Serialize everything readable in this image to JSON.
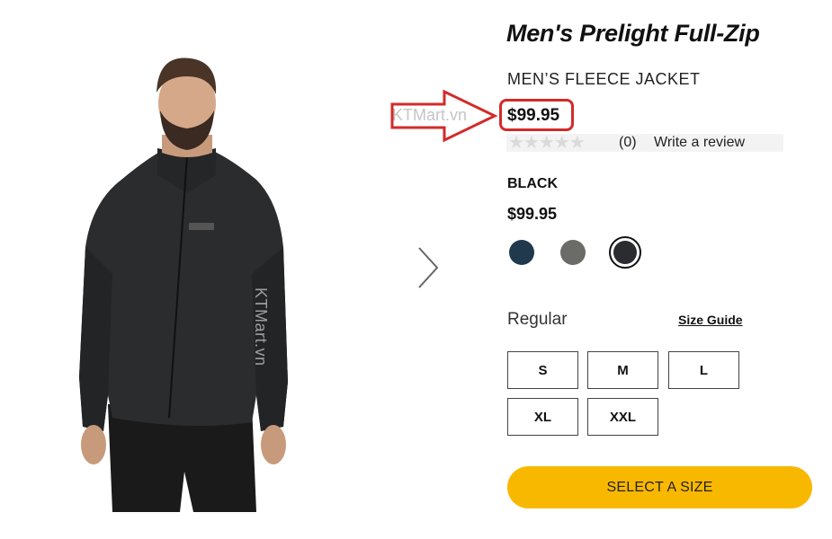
{
  "product": {
    "title": "Men's Prelight Full-Zip",
    "subtitle": "MEN’S FLEECE JACKET",
    "price": "$99.95",
    "rating": {
      "stars": "★★★★★",
      "count": "(0)",
      "write_review": "Write a review"
    },
    "color_name": "BLACK",
    "price_secondary": "$99.95",
    "swatches": [
      {
        "name": "navy",
        "color": "#20394d"
      },
      {
        "name": "grey",
        "color": "#6b6b68"
      },
      {
        "name": "black",
        "color": "#2a2c30",
        "selected": true
      }
    ],
    "fit": "Regular",
    "size_guide": "Size Guide",
    "sizes": [
      "S",
      "M",
      "L",
      "XL",
      "XXL"
    ],
    "cta": "SELECT A SIZE"
  },
  "watermark": "KTMart.vn",
  "colors": {
    "accent": "#f9b800",
    "highlight": "#d32a2a"
  }
}
